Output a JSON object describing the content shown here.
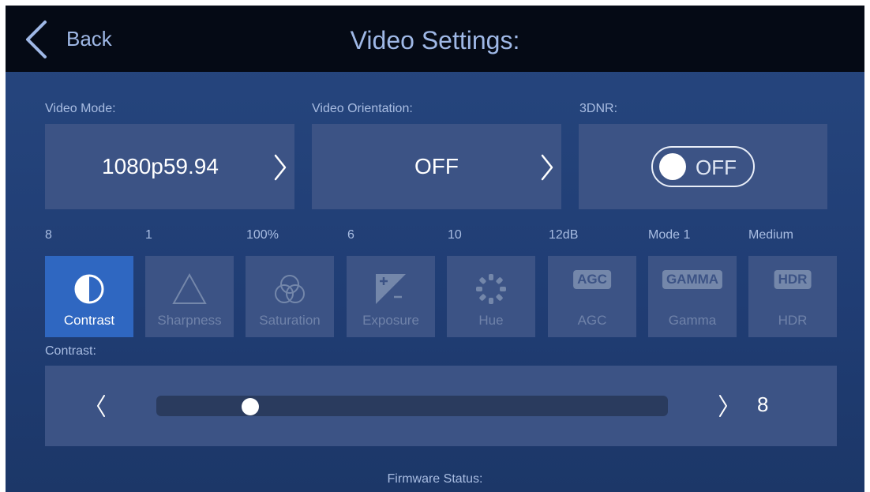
{
  "header": {
    "back_label": "Back",
    "title": "Video Settings:"
  },
  "settings": {
    "video_mode": {
      "label": "Video Mode:",
      "value": "1080p59.94"
    },
    "orientation": {
      "label": "Video Orientation:",
      "value": "OFF"
    },
    "dnr": {
      "label": "3DNR:",
      "state": "OFF"
    }
  },
  "params": [
    {
      "value": "8",
      "label": "Contrast",
      "icon": "contrast-icon",
      "active": true
    },
    {
      "value": "1",
      "label": "Sharpness",
      "icon": "sharpness-triangle-icon"
    },
    {
      "value": "100%",
      "label": "Saturation",
      "icon": "saturation-circles-icon"
    },
    {
      "value": "6",
      "label": "Exposure",
      "icon": "exposure-icon"
    },
    {
      "value": "10",
      "label": "Hue",
      "icon": "hue-dots-icon"
    },
    {
      "value": "12dB",
      "label": "AGC",
      "icon": "agc-badge-icon",
      "badge": "AGC"
    },
    {
      "value": "Mode 1",
      "label": "Gamma",
      "icon": "gamma-badge-icon",
      "badge": "GAMMA"
    },
    {
      "value": "Medium",
      "label": "HDR",
      "icon": "hdr-badge-icon",
      "badge": "HDR"
    }
  ],
  "slider": {
    "label": "Contrast:",
    "value": "8",
    "level_fraction": 0.1
  },
  "footer": {
    "firmware_label": "Firmware Status:"
  },
  "colors": {
    "active_tile": "#2f67c1",
    "card": "#3c5385",
    "topbar": "#050a15",
    "accent_text": "#9fb8e6"
  }
}
